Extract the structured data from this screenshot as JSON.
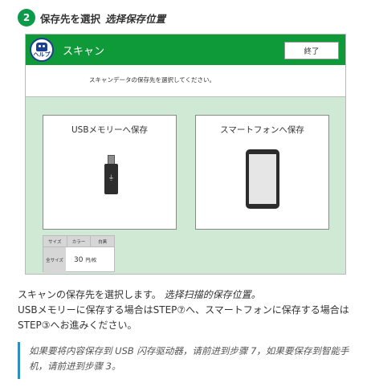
{
  "step": {
    "number": "2",
    "title": "保存先を選択",
    "title_cn": "选择保存位置"
  },
  "device": {
    "help_label": "ヘルプ",
    "screen_title": "スキャン",
    "end_button": "終了",
    "message": "スキャンデータの保存先を選択してください。",
    "options": [
      {
        "label": "USBメモリーへ保存",
        "icon": "usb-flash-drive-icon"
      },
      {
        "label": "スマートフォンへ保存",
        "icon": "smartphone-icon"
      }
    ],
    "price": {
      "tabs": [
        "サイズ",
        "カラー",
        "白黒"
      ],
      "size": "全サイズ",
      "value": "30",
      "unit": "円/枚"
    },
    "colors": {
      "topbar": "#0f9a3a",
      "background": "#cfe9d4"
    }
  },
  "description": {
    "line1": "スキャンの保存先を選択します。",
    "line1_cn": "选择扫描的保存位置。",
    "line2": "USBメモリーに保存する場合はSTEP⑦へ、スマートフォンに保存する場合はSTEP③へお進みください。"
  },
  "note": {
    "text": "如果要将内容保存到 USB 闪存驱动器，请前进到步骤 7，如果要保存到智能手机，请前进到步骤 3。",
    "accent_color": "#2a8ec8"
  }
}
